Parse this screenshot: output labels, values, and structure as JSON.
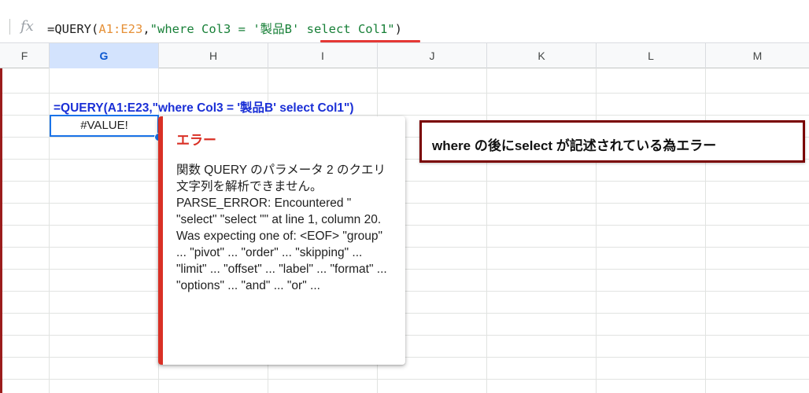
{
  "formula_bar": {
    "fx_icon": "fx-icon",
    "formula_parts": [
      "=QUERY(",
      "A1:E23",
      ",",
      "\"where Col3 = '製品B' select Col1\"",
      ")"
    ]
  },
  "columns": [
    "F",
    "G",
    "H",
    "I",
    "J",
    "K",
    "L",
    "M"
  ],
  "active_column": "G",
  "cells": {
    "formula_text": "=QUERY(A1:E23,\"where Col3 = '製品B' select Col1\")",
    "active_value": "#VALUE!"
  },
  "error_popup": {
    "title": "エラー",
    "message": "関数 QUERY のパラメータ 2 のクエリ文字列を解析できません。PARSE_ERROR: Encountered \" \"select\" \"select \"\" at line 1, column 20. Was expecting one of: <EOF> \"group\" ... \"pivot\" ... \"order\" ... \"skipping\" ... \"limit\" ... \"offset\" ... \"label\" ... \"format\" ... \"options\" ... \"and\" ... \"or\" ..."
  },
  "annotation": {
    "text": "where の後にselect が記述されている為エラー"
  },
  "colors": {
    "error_red": "#d93025",
    "annotation_border": "#7a0000",
    "formula_blue": "#1a2fd6",
    "active_blue": "#1a73e8"
  }
}
